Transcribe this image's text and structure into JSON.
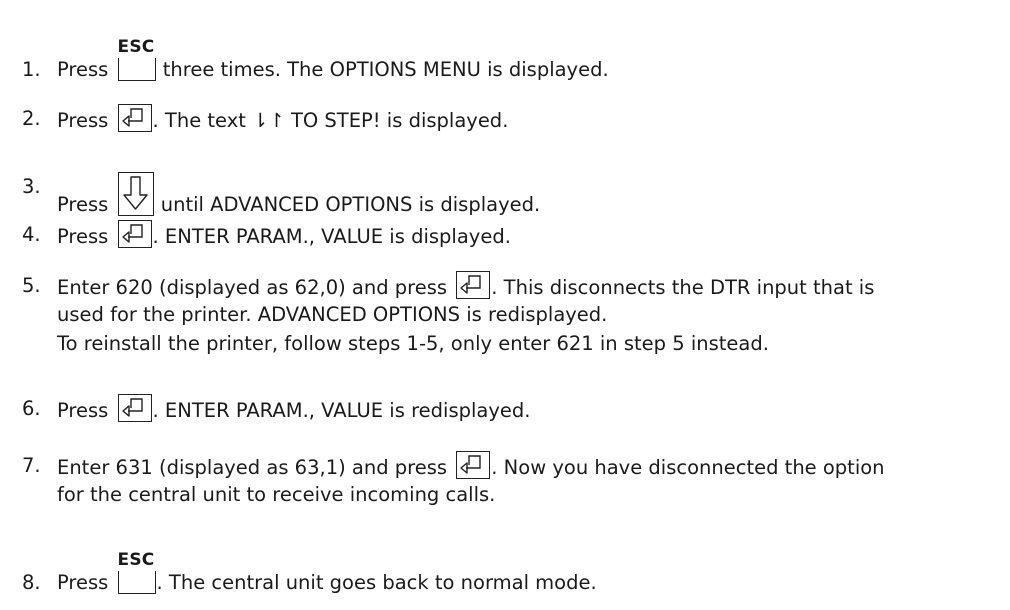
{
  "steps": [
    {
      "num": "1.",
      "parts": {
        "a": "Press",
        "key": "ESC",
        "b": "three times. The OPTIONS MENU is displayed."
      }
    },
    {
      "num": "2.",
      "parts": {
        "a": "Press",
        "b": ". The text ⇂↾ TO STEP! is displayed."
      }
    },
    {
      "num": "3.",
      "parts": {
        "a": "Press",
        "b": "until ADVANCED OPTIONS is displayed."
      }
    },
    {
      "num": "4.",
      "parts": {
        "a": "Press",
        "b": ". ENTER PARAM., VALUE is displayed."
      }
    },
    {
      "num": "5.",
      "parts": {
        "a": "Enter 620 (displayed as 62,0) and press",
        "b": ". This disconnects the DTR input that is",
        "c": "used for the printer. ADVANCED OPTIONS is redisplayed.",
        "d": "To reinstall the printer, follow steps 1-5, only enter 621 in step 5 instead."
      }
    },
    {
      "num": "6.",
      "parts": {
        "a": "Press",
        "b": ". ENTER PARAM., VALUE is redisplayed."
      }
    },
    {
      "num": "7.",
      "parts": {
        "a": "Enter 631 (displayed as 63,1) and press",
        "b": ". Now you have disconnected the option",
        "c": "for the central unit to receive incoming calls."
      }
    },
    {
      "num": "8.",
      "parts": {
        "a": "Press",
        "key": "ESC",
        "b": ". The central unit goes back to normal mode."
      }
    }
  ],
  "icons": {
    "esc_key": "esc-key-icon",
    "enter_key": "enter-key-icon",
    "down_arrow_key": "down-arrow-key-icon"
  }
}
